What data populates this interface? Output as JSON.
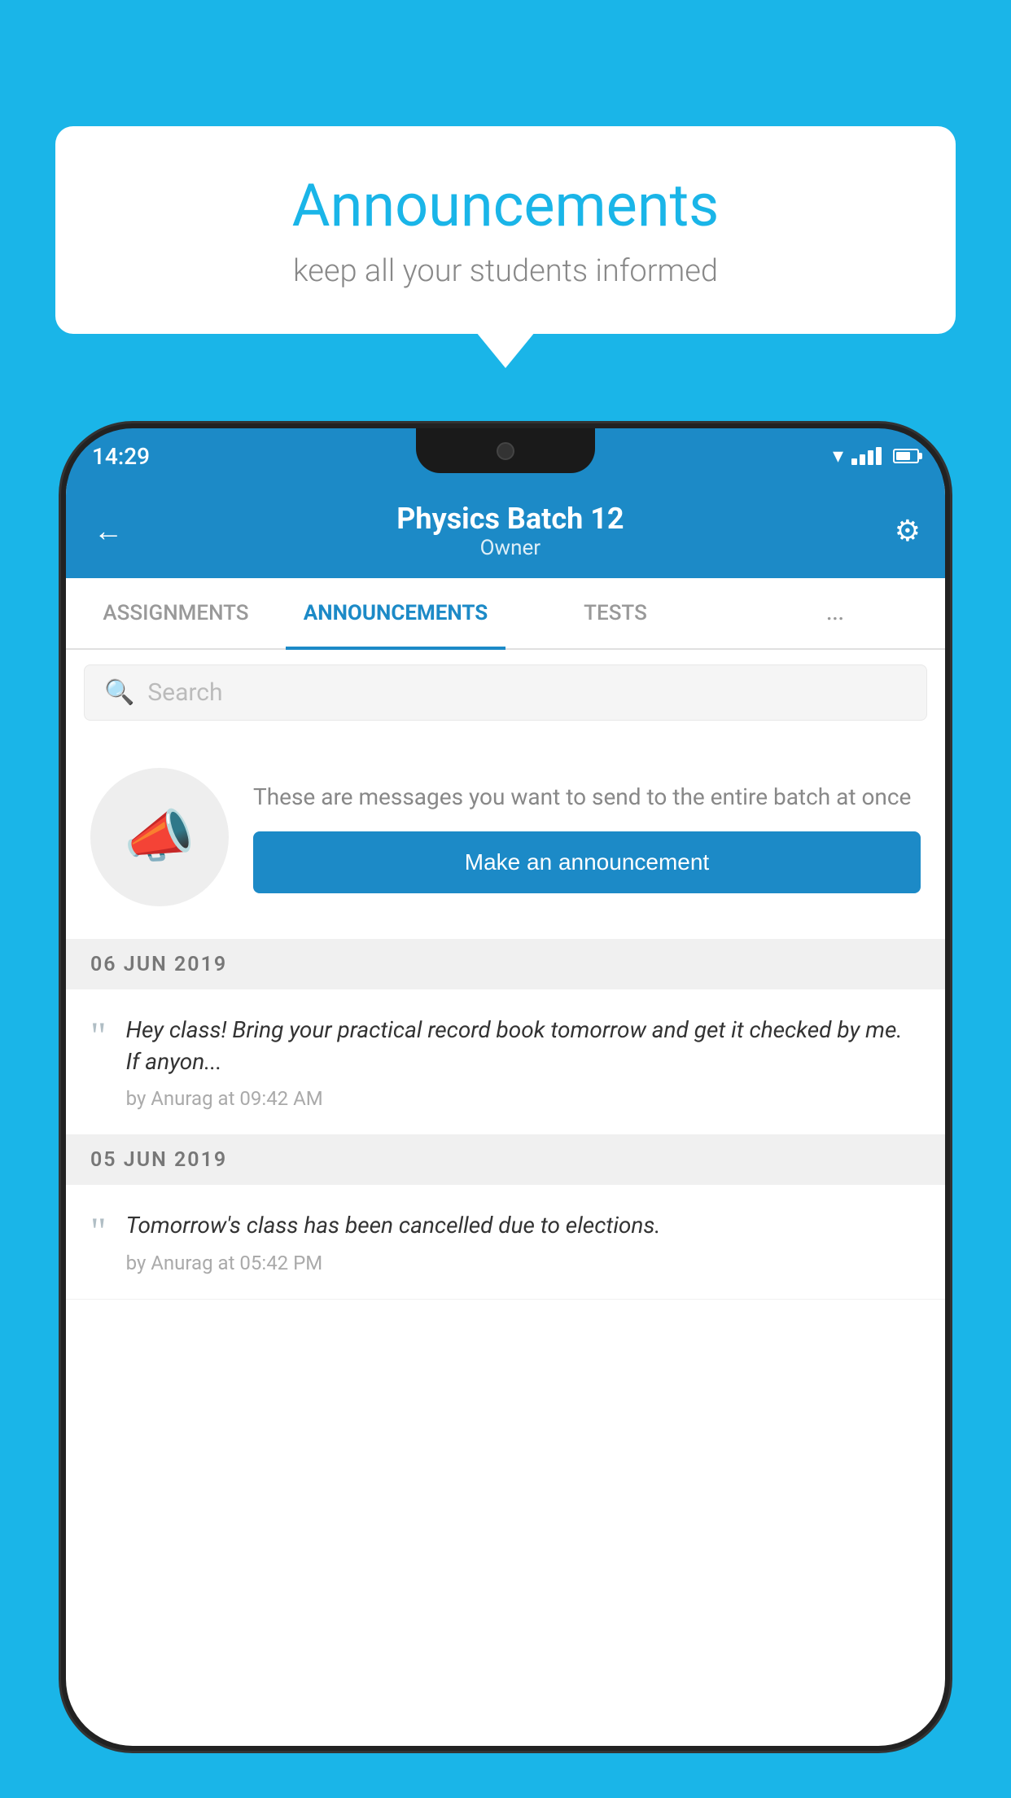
{
  "page": {
    "background_color": "#1ab5e8"
  },
  "speech_bubble": {
    "title": "Announcements",
    "subtitle": "keep all your students informed"
  },
  "status_bar": {
    "time": "14:29"
  },
  "app_header": {
    "title": "Physics Batch 12",
    "subtitle": "Owner",
    "back_label": "←",
    "gear_label": "⚙"
  },
  "tabs": [
    {
      "label": "ASSIGNMENTS",
      "active": false
    },
    {
      "label": "ANNOUNCEMENTS",
      "active": true
    },
    {
      "label": "TESTS",
      "active": false
    },
    {
      "label": "...",
      "active": false
    }
  ],
  "search": {
    "placeholder": "Search"
  },
  "cta_section": {
    "description": "These are messages you want to send to the entire batch at once",
    "button_label": "Make an announcement"
  },
  "announcements": [
    {
      "date": "06  JUN  2019",
      "message": "Hey class! Bring your practical record book tomorrow and get it checked by me. If anyon...",
      "meta": "by Anurag at 09:42 AM"
    },
    {
      "date": "05  JUN  2019",
      "message": "Tomorrow's class has been cancelled due to elections.",
      "meta": "by Anurag at 05:42 PM"
    }
  ]
}
